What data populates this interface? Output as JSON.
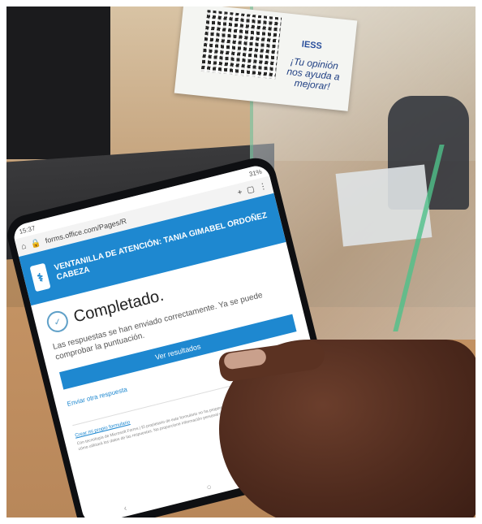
{
  "sign": {
    "logo": "IESS",
    "text": "¡Tu opinión nos ayuda a mejorar!"
  },
  "phone": {
    "status_left": "15:37",
    "status_right": "31%",
    "url": "forms.office.com/Pages/R",
    "banner_title": "VENTANILLA DE ATENCIÓN: TANIA GIMABEL ORDOÑEZ CABEZA",
    "done_title": "Completado.",
    "message": "Las respuestas se han enviado correctamente. Ya se puede comprobar la puntuación.",
    "results_button": "Ver resultados",
    "send_again": "Enviar otra respuesta",
    "footer_link": "Crear mi propio formulario",
    "footer_text": "Con tecnología de Microsoft Forms | El propietario de este formulario no ha proporcionado ninguna declaración de privacidad sobre cómo utilizará los datos de las respuestas. No proporcione información personal o confidencial. | Términos de uso"
  }
}
